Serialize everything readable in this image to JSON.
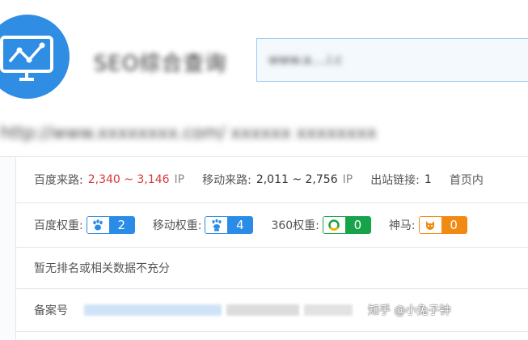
{
  "header": {
    "title": "SEO综合查询",
    "search_value": "www.a....i.c"
  },
  "site_url": "http://www.xxxxxxxx.com/ xxxxxx xxxxxxxx",
  "traffic": {
    "baidu_label": "百度来路:",
    "baidu_value": "2,340 ~ 3,146",
    "baidu_unit": "IP",
    "mobile_label": "移动来路:",
    "mobile_value": "2,011 ~ 2,756",
    "mobile_unit": "IP",
    "outlinks_label": "出站链接:",
    "outlinks_value": "1",
    "homepage_label": "首页内"
  },
  "weights": {
    "baidu_label": "百度权重:",
    "baidu_value": "2",
    "mobile_label": "移动权重:",
    "mobile_value": "4",
    "s360_label": "360权重:",
    "s360_value": "0",
    "shenma_label": "神马:",
    "shenma_value": "0"
  },
  "ranking_note": "暂无排名或相关数据不充分",
  "beian_label": "备案号",
  "watermark": "知乎 @小兔子钟",
  "colors": {
    "blue": "#2a8ce6",
    "green": "#17a34a",
    "orange": "#f18a12",
    "red": "#d93838"
  },
  "icons": {
    "logo": "monitor-chart-icon",
    "baidu": "paw-icon",
    "mobile": "mobile-paw-icon",
    "s360": "360-ring-icon",
    "shenma": "shenma-icon"
  }
}
